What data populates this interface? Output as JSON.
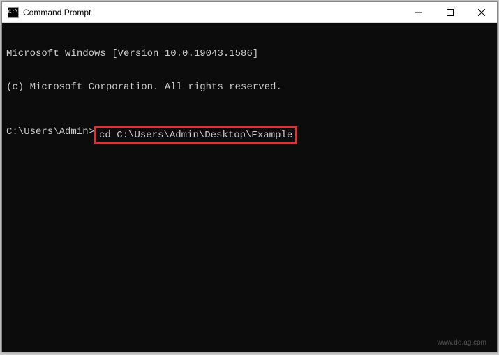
{
  "titlebar": {
    "icon_label": "C:\\",
    "title": "Command Prompt"
  },
  "terminal": {
    "line1": "Microsoft Windows [Version 10.0.19043.1586]",
    "line2": "(c) Microsoft Corporation. All rights reserved.",
    "prompt": "C:\\Users\\Admin>",
    "command": "cd C:\\Users\\Admin\\Desktop\\Example"
  },
  "highlight_color": "#e03030",
  "watermark": "www.de.ag.com"
}
